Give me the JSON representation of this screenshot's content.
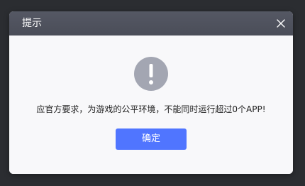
{
  "dialog": {
    "title": "提示",
    "message": "应官方要求，为游戏的公平环境，不能同时运行超过0个APP!",
    "confirm_label": "确定"
  },
  "icons": {
    "close": "close-icon",
    "alert": "exclamation-circle-icon"
  },
  "colors": {
    "titlebar": "#4f525d",
    "body": "#f8f8fa",
    "alert_icon": "#a3a6b2",
    "primary_button": "#5075ff"
  }
}
